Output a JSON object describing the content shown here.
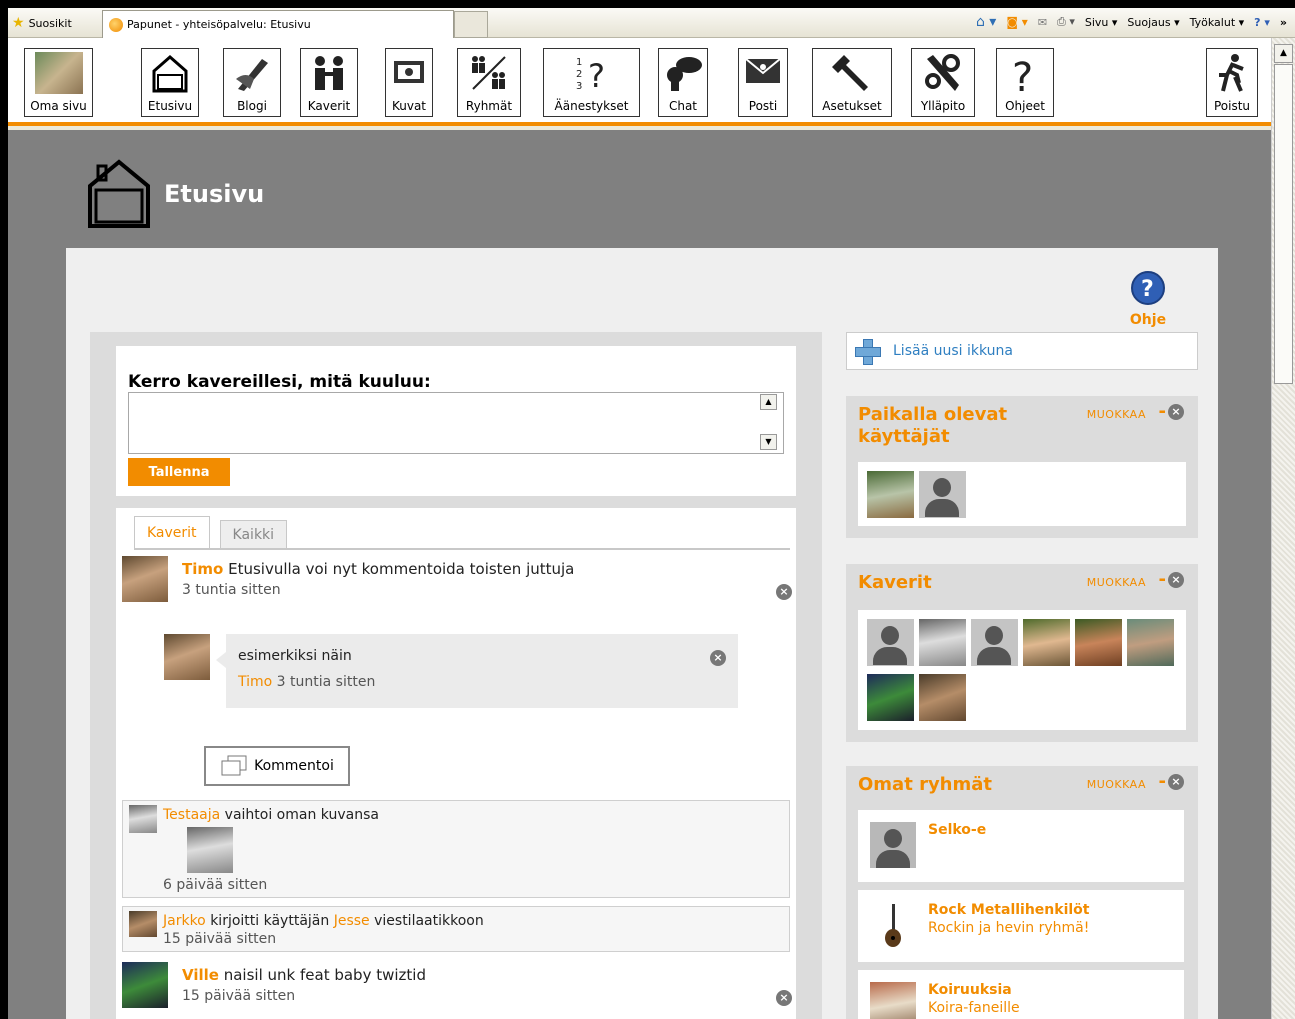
{
  "browser": {
    "favorites": "Suosikit",
    "tab_title": "Papunet - yhteisöpalvelu: Etusivu",
    "menu": [
      "Sivu ▾",
      "Suojaus ▾",
      "Työkalut ▾"
    ]
  },
  "nav": {
    "items": [
      "Oma sivu",
      "Etusivu",
      "Blogi",
      "Kaverit",
      "Kuvat",
      "Ryhmät",
      "Äänestykset",
      "Chat",
      "Posti",
      "Asetukset",
      "Ylläpito",
      "Ohjeet"
    ],
    "logout": "Poistu"
  },
  "page": {
    "title": "Etusivu",
    "help": "Ohje"
  },
  "status": {
    "question": "Kerro kavereillesi, mitä kuuluu:",
    "save": "Tallenna"
  },
  "feed": {
    "tabs": [
      "Kaverit",
      "Kaikki"
    ],
    "post1": {
      "user": "Timo",
      "text": "Etusivulla voi nyt kommentoida toisten juttuja",
      "time": "3 tuntia sitten"
    },
    "comment1": {
      "text": "esimerkiksi näin",
      "user": "Timo",
      "time": "3 tuntia sitten"
    },
    "comment_button": "Kommentoi",
    "post2": {
      "user": "Testaaja",
      "text": "vaihtoi oman kuvansa",
      "time": "6 päivää sitten"
    },
    "post3": {
      "user": "Jarkko",
      "text": "kirjoitti käyttäjän",
      "target": "Jesse",
      "text2": "viestilaatikkoon",
      "time": "15 päivää sitten"
    },
    "post4": {
      "user": "Ville",
      "text": "naisil unk feat baby twiztid",
      "time": "15 päivää sitten"
    }
  },
  "sidebar": {
    "add_window": "Lisää uusi ikkuna",
    "edit": "MUOKKAA",
    "online_title": "Paikalla olevat käyttäjät",
    "friends_title": "Kaverit",
    "groups_title": "Omat ryhmät",
    "groups": [
      {
        "name": "Selko-e",
        "desc": ""
      },
      {
        "name": "Rock Metallihenkilöt",
        "desc": "Rockin ja hevin ryhmä!"
      },
      {
        "name": "Koiruuksia",
        "desc": "Koira-faneille"
      }
    ]
  },
  "colors": {
    "accent": "#f28c00",
    "page_bg": "#808080",
    "link": "#2f7fc1"
  }
}
